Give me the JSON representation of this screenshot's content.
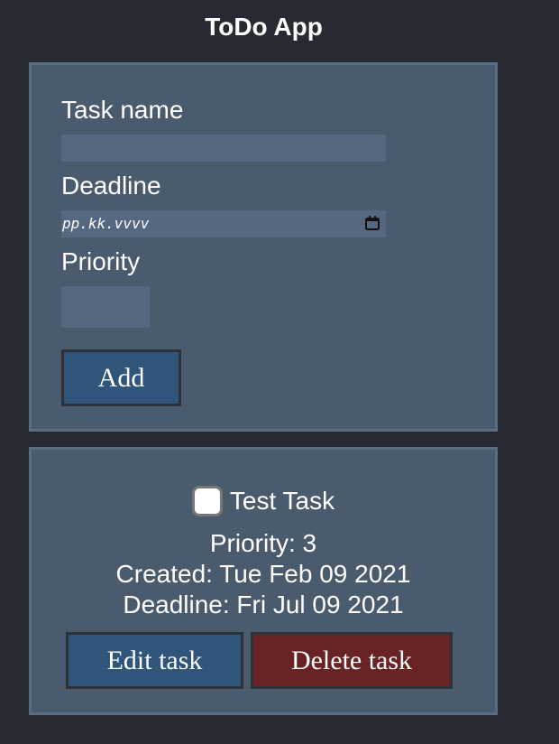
{
  "app": {
    "title": "ToDo App"
  },
  "form": {
    "task_name_label": "Task name",
    "task_name_value": "",
    "deadline_label": "Deadline",
    "deadline_placeholder": "pp.kk.vvvv",
    "priority_label": "Priority",
    "priority_value": "",
    "add_label": "Add"
  },
  "task": {
    "name": "Test Task",
    "checked": false,
    "priority_text": "Priority: 3",
    "created_text": "Created: Tue Feb 09 2021",
    "deadline_text": "Deadline: Fri Jul 09 2021",
    "edit_label": "Edit task",
    "delete_label": "Delete task"
  },
  "colors": {
    "background": "#272a33",
    "panel": "#4b5b6e",
    "input": "#56687f",
    "primary_button": "#30557b",
    "danger_button": "#6a2324"
  },
  "icons": {
    "deadline_picker": "calendar-icon"
  }
}
